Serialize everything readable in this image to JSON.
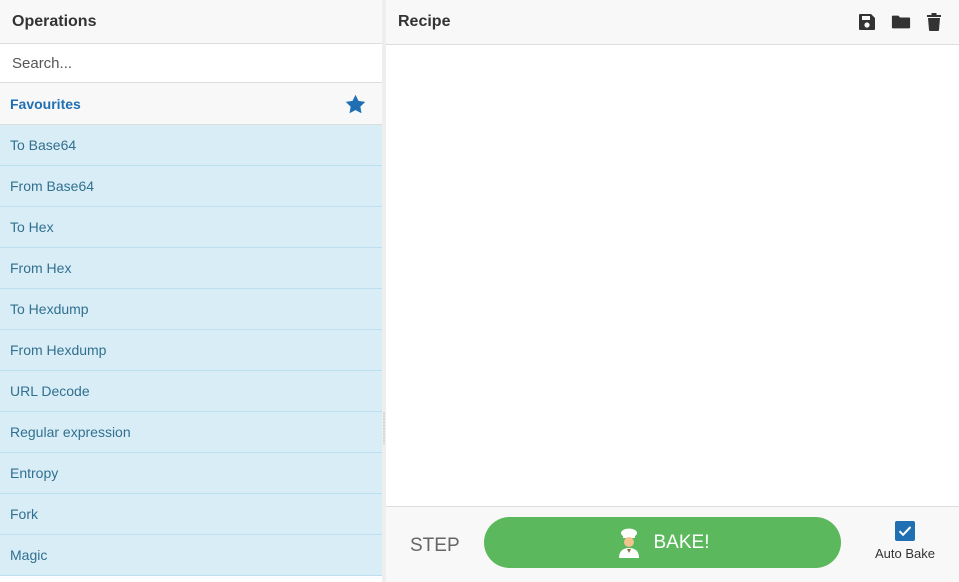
{
  "operations": {
    "title": "Operations",
    "search_placeholder": "Search...",
    "favourites_label": "Favourites",
    "items": [
      {
        "label": "To Base64"
      },
      {
        "label": "From Base64"
      },
      {
        "label": "To Hex"
      },
      {
        "label": "From Hex"
      },
      {
        "label": "To Hexdump"
      },
      {
        "label": "From Hexdump"
      },
      {
        "label": "URL Decode"
      },
      {
        "label": "Regular expression"
      },
      {
        "label": "Entropy"
      },
      {
        "label": "Fork"
      },
      {
        "label": "Magic"
      }
    ]
  },
  "recipe": {
    "title": "Recipe",
    "icons": [
      "save-icon",
      "folder-icon",
      "trash-icon"
    ]
  },
  "controls": {
    "step_label": "STEP",
    "bake_label": "BAKE!",
    "auto_bake_label": "Auto Bake",
    "auto_bake_checked": true
  },
  "colors": {
    "accent": "#1f6fb2",
    "bake_green": "#5cb85c",
    "op_item_bg": "#d9edf7",
    "op_item_text": "#31708f"
  }
}
